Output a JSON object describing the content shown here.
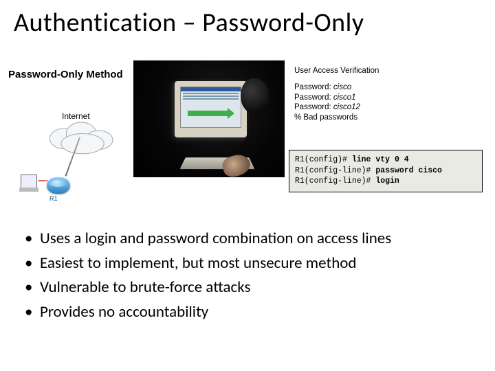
{
  "title": "Authentication – Password-Only",
  "method_label": "Password-Only Method",
  "diagram": {
    "internet_label": "Internet",
    "router_label": "R1"
  },
  "verification": {
    "header": "User Access Verification",
    "attempts": [
      {
        "label": "Password:",
        "value": "cisco"
      },
      {
        "label": "Password:",
        "value": "cisco1"
      },
      {
        "label": "Password:",
        "value": "cisco12"
      }
    ],
    "fail_msg": "% Bad passwords"
  },
  "code": {
    "lines": [
      {
        "prompt": "R1(config)# ",
        "cmd": "line vty 0 4"
      },
      {
        "prompt": "R1(config-line)# ",
        "cmd": "password cisco"
      },
      {
        "prompt": "R1(config-line)# ",
        "cmd": "login"
      }
    ]
  },
  "bullets": [
    "Uses a login and password combination on access lines",
    "Easiest to implement, but most unsecure method",
    "Vulnerable to brute-force attacks",
    "Provides no accountability"
  ]
}
